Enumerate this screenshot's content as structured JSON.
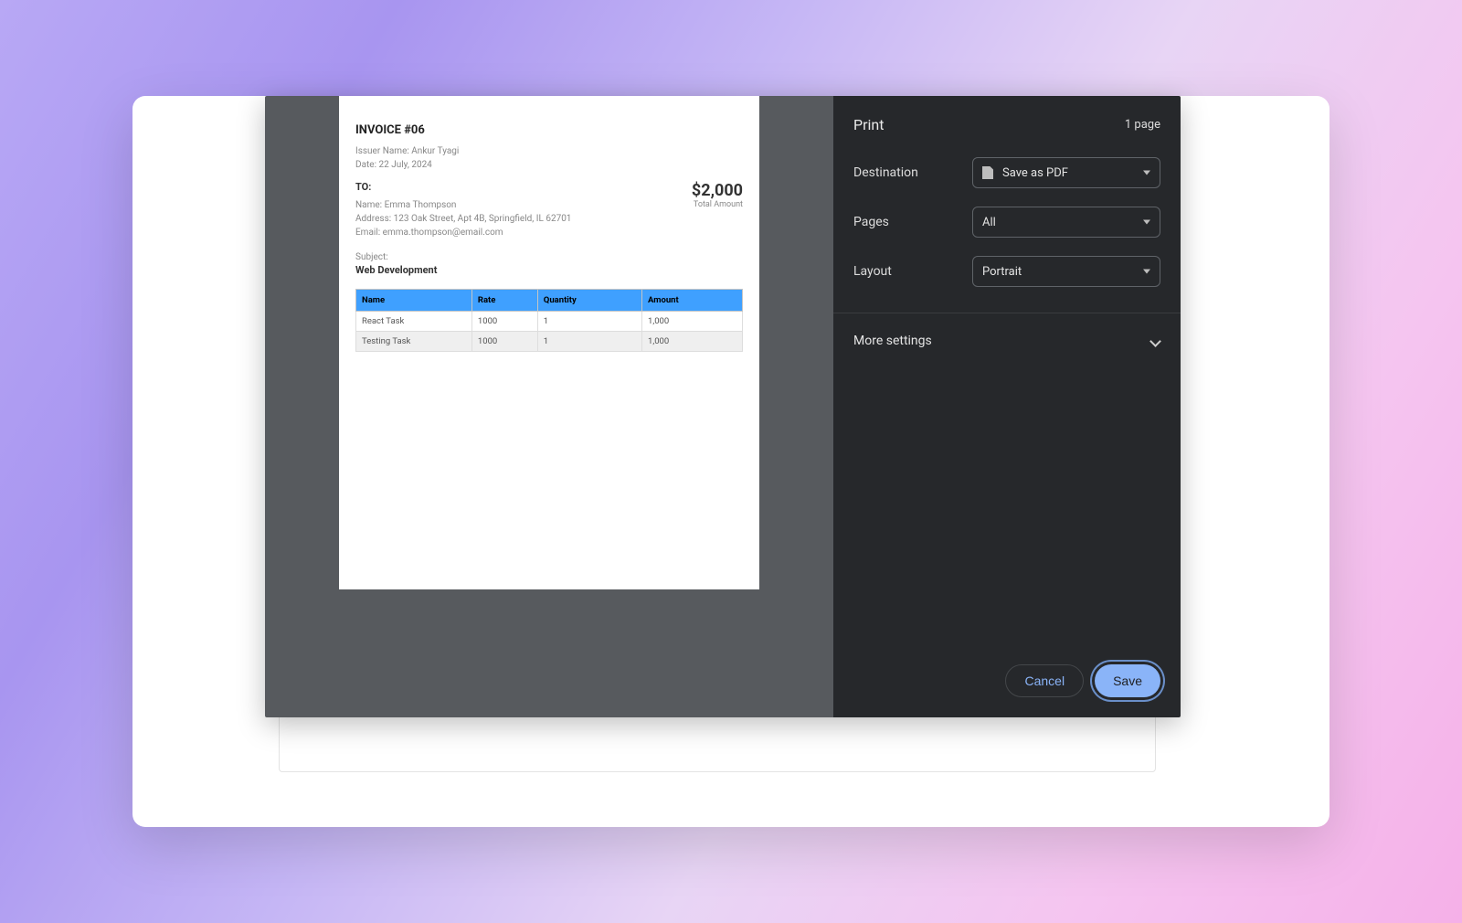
{
  "dialog": {
    "title": "Print",
    "page_count": "1 page",
    "fields": {
      "destination_label": "Destination",
      "destination_value": "Save as PDF",
      "pages_label": "Pages",
      "pages_value": "All",
      "layout_label": "Layout",
      "layout_value": "Portrait"
    },
    "more_settings": "More settings",
    "cancel": "Cancel",
    "save": "Save"
  },
  "invoice": {
    "title": "INVOICE #06",
    "issuer_label": "Issuer Name:",
    "issuer_value": "Ankur Tyagi",
    "date_label": "Date:",
    "date_value": "22 July, 2024",
    "to_label": "TO:",
    "to_name_label": "Name:",
    "to_name": "Emma Thompson",
    "to_address_label": "Address:",
    "to_address": "123 Oak Street, Apt 4B, Springfield, IL 62701",
    "to_email_label": "Email:",
    "to_email": "emma.thompson@email.com",
    "total_amount": "$2,000",
    "total_label": "Total Amount",
    "subject_label": "Subject:",
    "subject_value": "Web Development",
    "columns": [
      "Name",
      "Rate",
      "Quantity",
      "Amount"
    ],
    "rows": [
      {
        "name": "React Task",
        "rate": "1000",
        "qty": "1",
        "amount": "1,000"
      },
      {
        "name": "Testing Task",
        "rate": "1000",
        "qty": "1",
        "amount": "1,000"
      }
    ]
  }
}
